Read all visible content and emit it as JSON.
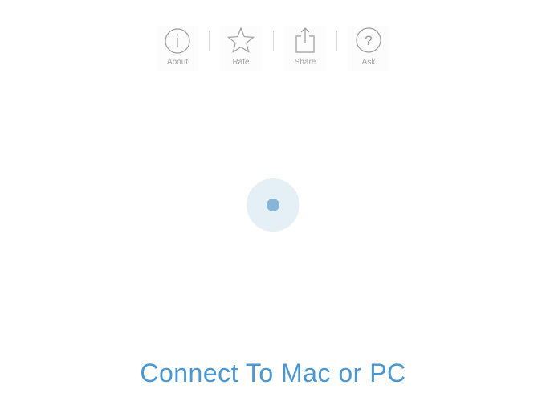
{
  "toolbar": {
    "items": [
      {
        "label": "About",
        "icon": "info-icon"
      },
      {
        "label": "Rate",
        "icon": "star-icon"
      },
      {
        "label": "Share",
        "icon": "share-icon"
      },
      {
        "label": "Ask",
        "icon": "question-icon"
      }
    ]
  },
  "main": {
    "title": "Connect To Mac or PC"
  },
  "colors": {
    "accent": "#4a98d3",
    "indicator_ring": "#e5eff6",
    "indicator_dot": "#86b5d8",
    "icon_gray": "#9c9c9c"
  }
}
